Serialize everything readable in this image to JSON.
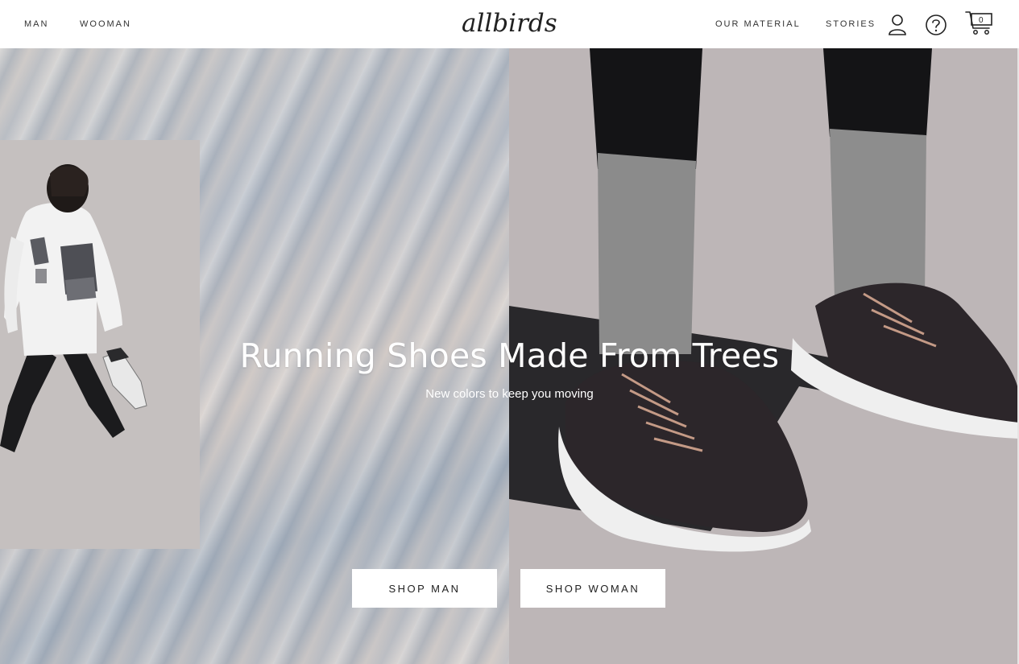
{
  "header": {
    "nav_left": [
      "MAN",
      "WOOMAN"
    ],
    "logo_text": "allbirds",
    "nav_right": [
      "OUR MATERIAL",
      "STORIES"
    ],
    "cart_count": "0",
    "icons": [
      "account-icon",
      "help-icon",
      "cart-icon"
    ]
  },
  "hero": {
    "title": "Running Shoes Made From Trees",
    "subtitle": "New colors to keep you moving",
    "cta": [
      "SHOP MAN",
      "SHOP WOMAN"
    ]
  },
  "colors": {
    "header_bg": "#ffffff",
    "text": "#212121",
    "button_bg": "#ffffff",
    "hero_right_bg": "#bdb6b7"
  }
}
